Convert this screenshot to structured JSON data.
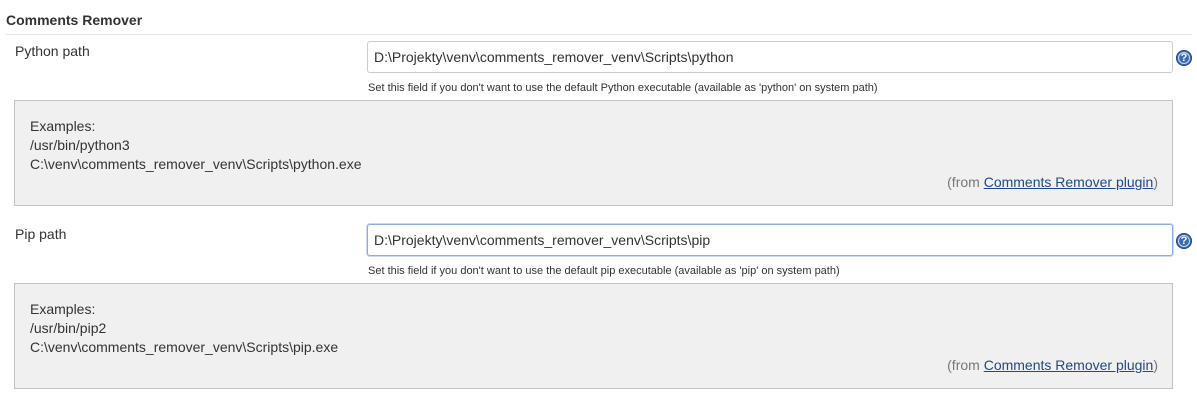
{
  "section": {
    "title": "Comments Remover"
  },
  "fields": [
    {
      "label": "Python path",
      "value": "D:\\Projekty\\venv\\comments_remover_venv\\Scripts\\python",
      "hint": "Set this field if you don't want to use the default Python executable (available as 'python' on system path)",
      "help_icon": "question-circle-icon",
      "help": {
        "lines": [
          "Examples:",
          "/usr/bin/python3",
          "C:\\venv\\comments_remover_venv\\Scripts\\python.exe"
        ],
        "from_prefix": "(from ",
        "from_link": "Comments Remover plugin",
        "from_suffix": ")"
      }
    },
    {
      "label": "Pip path",
      "value": "D:\\Projekty\\venv\\comments_remover_venv\\Scripts\\pip",
      "hint": "Set this field if you don't want to use the default pip executable (available as 'pip' on system path)",
      "help_icon": "question-circle-icon",
      "help": {
        "lines": [
          "Examples:",
          "/usr/bin/pip2",
          "C:\\venv\\comments_remover_venv\\Scripts\\pip.exe"
        ],
        "from_prefix": "(from ",
        "from_link": "Comments Remover plugin",
        "from_suffix": ")"
      }
    }
  ],
  "colors": {
    "help_icon": "#3a6bb3",
    "link": "#204a87",
    "help_box_bg": "#f0f0f0"
  }
}
